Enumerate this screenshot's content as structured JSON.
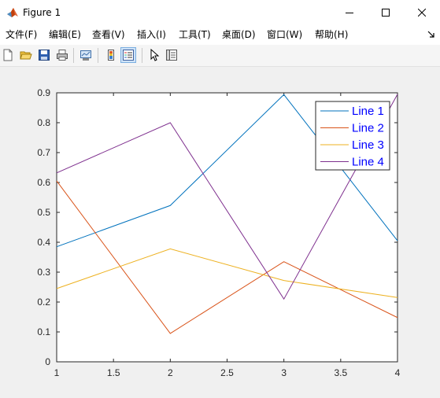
{
  "window": {
    "title": "Figure 1",
    "controls": [
      "minimize",
      "maximize",
      "close"
    ]
  },
  "menu": {
    "items": [
      {
        "label": "文件(F)"
      },
      {
        "label": "编辑(E)"
      },
      {
        "label": "查看(V)"
      },
      {
        "label": "插入(I)"
      },
      {
        "label": "工具(T)"
      },
      {
        "label": "桌面(D)"
      },
      {
        "label": "窗口(W)"
      },
      {
        "label": "帮助(H)"
      }
    ],
    "overflow_icon": "dock-arrow-icon"
  },
  "toolbar": {
    "buttons": [
      {
        "name": "new-figure-icon"
      },
      {
        "name": "open-file-icon"
      },
      {
        "name": "save-icon"
      },
      {
        "name": "print-icon"
      },
      {
        "name": "link-plot-icon"
      },
      {
        "name": "insert-colorbar-icon"
      },
      {
        "name": "insert-legend-icon",
        "active": true
      },
      {
        "name": "edit-plot-icon"
      },
      {
        "name": "property-inspector-icon"
      }
    ]
  },
  "chart_data": {
    "type": "line",
    "title": "",
    "xlabel": "",
    "ylabel": "",
    "xlim": [
      1,
      4
    ],
    "ylim": [
      0,
      0.9
    ],
    "xticks": [
      "1",
      "1.5",
      "2",
      "2.5",
      "3",
      "3.5",
      "4"
    ],
    "yticks": [
      "0",
      "0.1",
      "0.2",
      "0.3",
      "0.4",
      "0.5",
      "0.6",
      "0.7",
      "0.8",
      "0.9"
    ],
    "x": [
      1,
      2,
      3,
      4
    ],
    "series": [
      {
        "name": "Line 1",
        "values": [
          0.385,
          0.523,
          0.894,
          0.405
        ],
        "color": "#0072bd"
      },
      {
        "name": "Line 2",
        "values": [
          0.605,
          0.095,
          0.335,
          0.148
        ],
        "color": "#d95319"
      },
      {
        "name": "Line 3",
        "values": [
          0.245,
          0.378,
          0.272,
          0.215
        ],
        "color": "#edb120"
      },
      {
        "name": "Line 4",
        "values": [
          0.632,
          0.8,
          0.21,
          0.895
        ],
        "color": "#7e2f8e"
      }
    ],
    "legend": "top-right",
    "grid": false
  }
}
